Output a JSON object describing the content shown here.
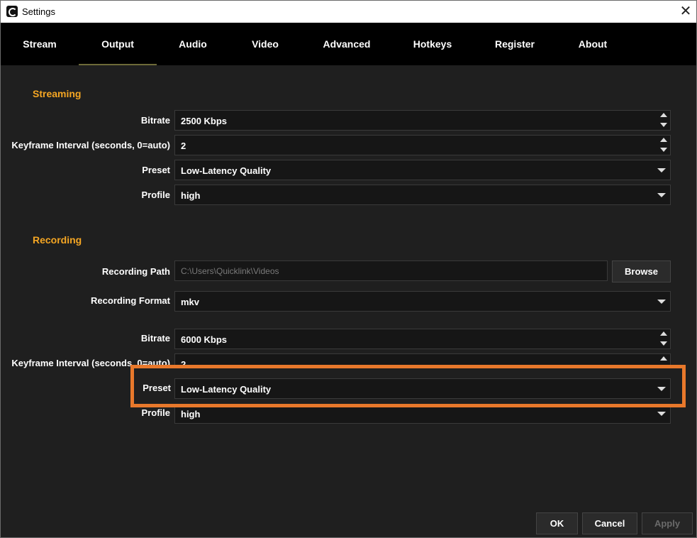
{
  "window": {
    "title": "Settings",
    "close_symbol": "✕"
  },
  "tabs": [
    {
      "label": "Stream"
    },
    {
      "label": "Output",
      "active": true
    },
    {
      "label": "Audio"
    },
    {
      "label": "Video"
    },
    {
      "label": "Advanced"
    },
    {
      "label": "Hotkeys"
    },
    {
      "label": "Register"
    },
    {
      "label": "About"
    }
  ],
  "streaming": {
    "title": "Streaming",
    "bitrate": {
      "label": "Bitrate",
      "value": "2500 Kbps"
    },
    "keyframe": {
      "label": "Keyframe Interval (seconds, 0=auto)",
      "value": "2"
    },
    "preset": {
      "label": "Preset",
      "value": "Low-Latency Quality"
    },
    "profile": {
      "label": "Profile",
      "value": "high"
    }
  },
  "recording": {
    "title": "Recording",
    "path": {
      "label": "Recording Path",
      "value": "C:\\Users\\Quicklink\\Videos",
      "browse_label": "Browse"
    },
    "format": {
      "label": "Recording Format",
      "value": "mkv"
    },
    "bitrate": {
      "label": "Bitrate",
      "value": "6000 Kbps"
    },
    "keyframe": {
      "label": "Keyframe Interval (seconds, 0=auto)",
      "value": "2"
    },
    "preset": {
      "label": "Preset",
      "value": "Low-Latency Quality"
    },
    "profile": {
      "label": "Profile",
      "value": "high"
    }
  },
  "footer": {
    "ok_label": "OK",
    "cancel_label": "Cancel",
    "apply_label": "Apply"
  },
  "colors": {
    "accent": "#f5a623",
    "highlight": "#e8782b"
  }
}
